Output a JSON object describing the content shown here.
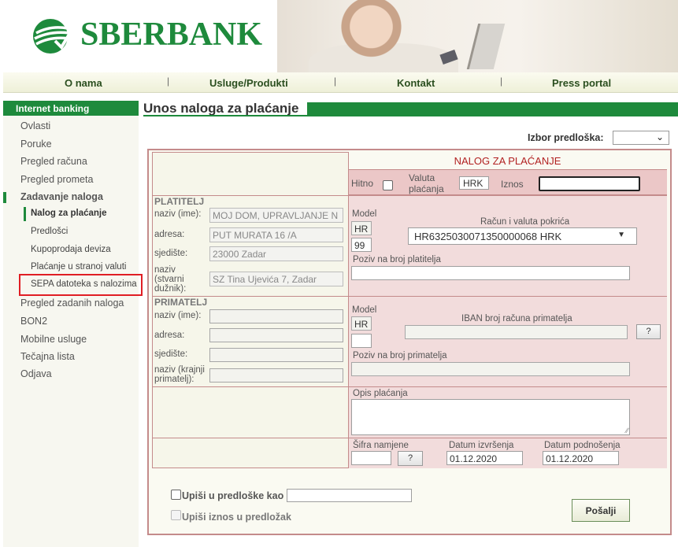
{
  "header": {
    "brand": "SBERBANK",
    "logo_icon": "sberbank-logo-icon"
  },
  "topnav": [
    "O nama",
    "Usluge/Produkti",
    "Kontakt",
    "Press portal"
  ],
  "sidebar": {
    "heading": "Internet banking",
    "items_top": [
      "Ovlasti",
      "Poruke",
      "Pregled računa",
      "Pregled prometa",
      "Zadavanje naloga"
    ],
    "sub_items": [
      "Nalog za plaćanje",
      "Predlošci",
      "Kupoprodaja deviza",
      "Plaćanje u stranoj valuti",
      "SEPA datoteka s nalozima"
    ],
    "items_bottom": [
      "Pregled zadanih naloga",
      "BON2",
      "Mobilne usluge",
      "Tečajna lista",
      "Odjava"
    ]
  },
  "main": {
    "title": "Unos naloga za plaćanje",
    "template_label": "Izbor predloška:",
    "template_value": ""
  },
  "form": {
    "title": "NALOG ZA PLAĆANJE",
    "hitno": "Hitno",
    "valuta_label_1": "Valuta",
    "valuta_label_2": "plaćanja",
    "valuta_value": "HRK",
    "iznos_label": "Iznos",
    "iznos_value": "",
    "platitelj": {
      "heading": "PLATITELJ",
      "naziv_label": "naziv (ime):",
      "naziv_value": "MOJ DOM, UPRAVLJANJE N",
      "adresa_label": "adresa:",
      "adresa_value": "PUT MURATA 16   /A",
      "sjediste_label": "sjedište:",
      "sjediste_value": "23000 Zadar",
      "dluznik_label_1": "naziv",
      "dluznik_label_2": "(stvarni",
      "dluznik_label_3": "dužnik):",
      "dluznik_value": "SZ Tina Ujevića 7, Zadar",
      "model_label": "Model",
      "model_hr": "HR",
      "model_num": "99",
      "racun_label": "Račun i valuta pokrića",
      "racun_value": "HR6325030071350000068 HRK",
      "poziv_label": "Poziv na broj platitelja",
      "poziv_value": ""
    },
    "primatelj": {
      "heading": "PRIMATELJ",
      "naziv_label": "naziv (ime):",
      "adresa_label": "adresa:",
      "sjediste_label": "sjedište:",
      "krajnji_label_1": "naziv (krajnji",
      "krajnji_label_2": "primatelj):",
      "model_label": "Model",
      "model_hr": "HR",
      "iban_label": "IBAN broj računa primatelja",
      "iban_btn": "?",
      "poziv_label": "Poziv na broj primatelja"
    },
    "opis_label": "Opis plaćanja",
    "sifra_label": "Šifra namjene",
    "sifra_btn": "?",
    "datum_izvrsenja_label": "Datum izvršenja",
    "datum_izvrsenja_value": "01.12.2020",
    "datum_podnosenja_label": "Datum podnošenja",
    "datum_podnosenja_value": "01.12.2020",
    "upisi_predloske": "Upiši u predloške kao",
    "upisi_iznos": "Upiši iznos u predložak",
    "send_label": "Pošalji"
  },
  "colors": {
    "brand_green": "#1e8a3c",
    "form_border": "#c48b8b",
    "form_pink": "#f2dcdc",
    "highlight_red": "#e01e24"
  }
}
